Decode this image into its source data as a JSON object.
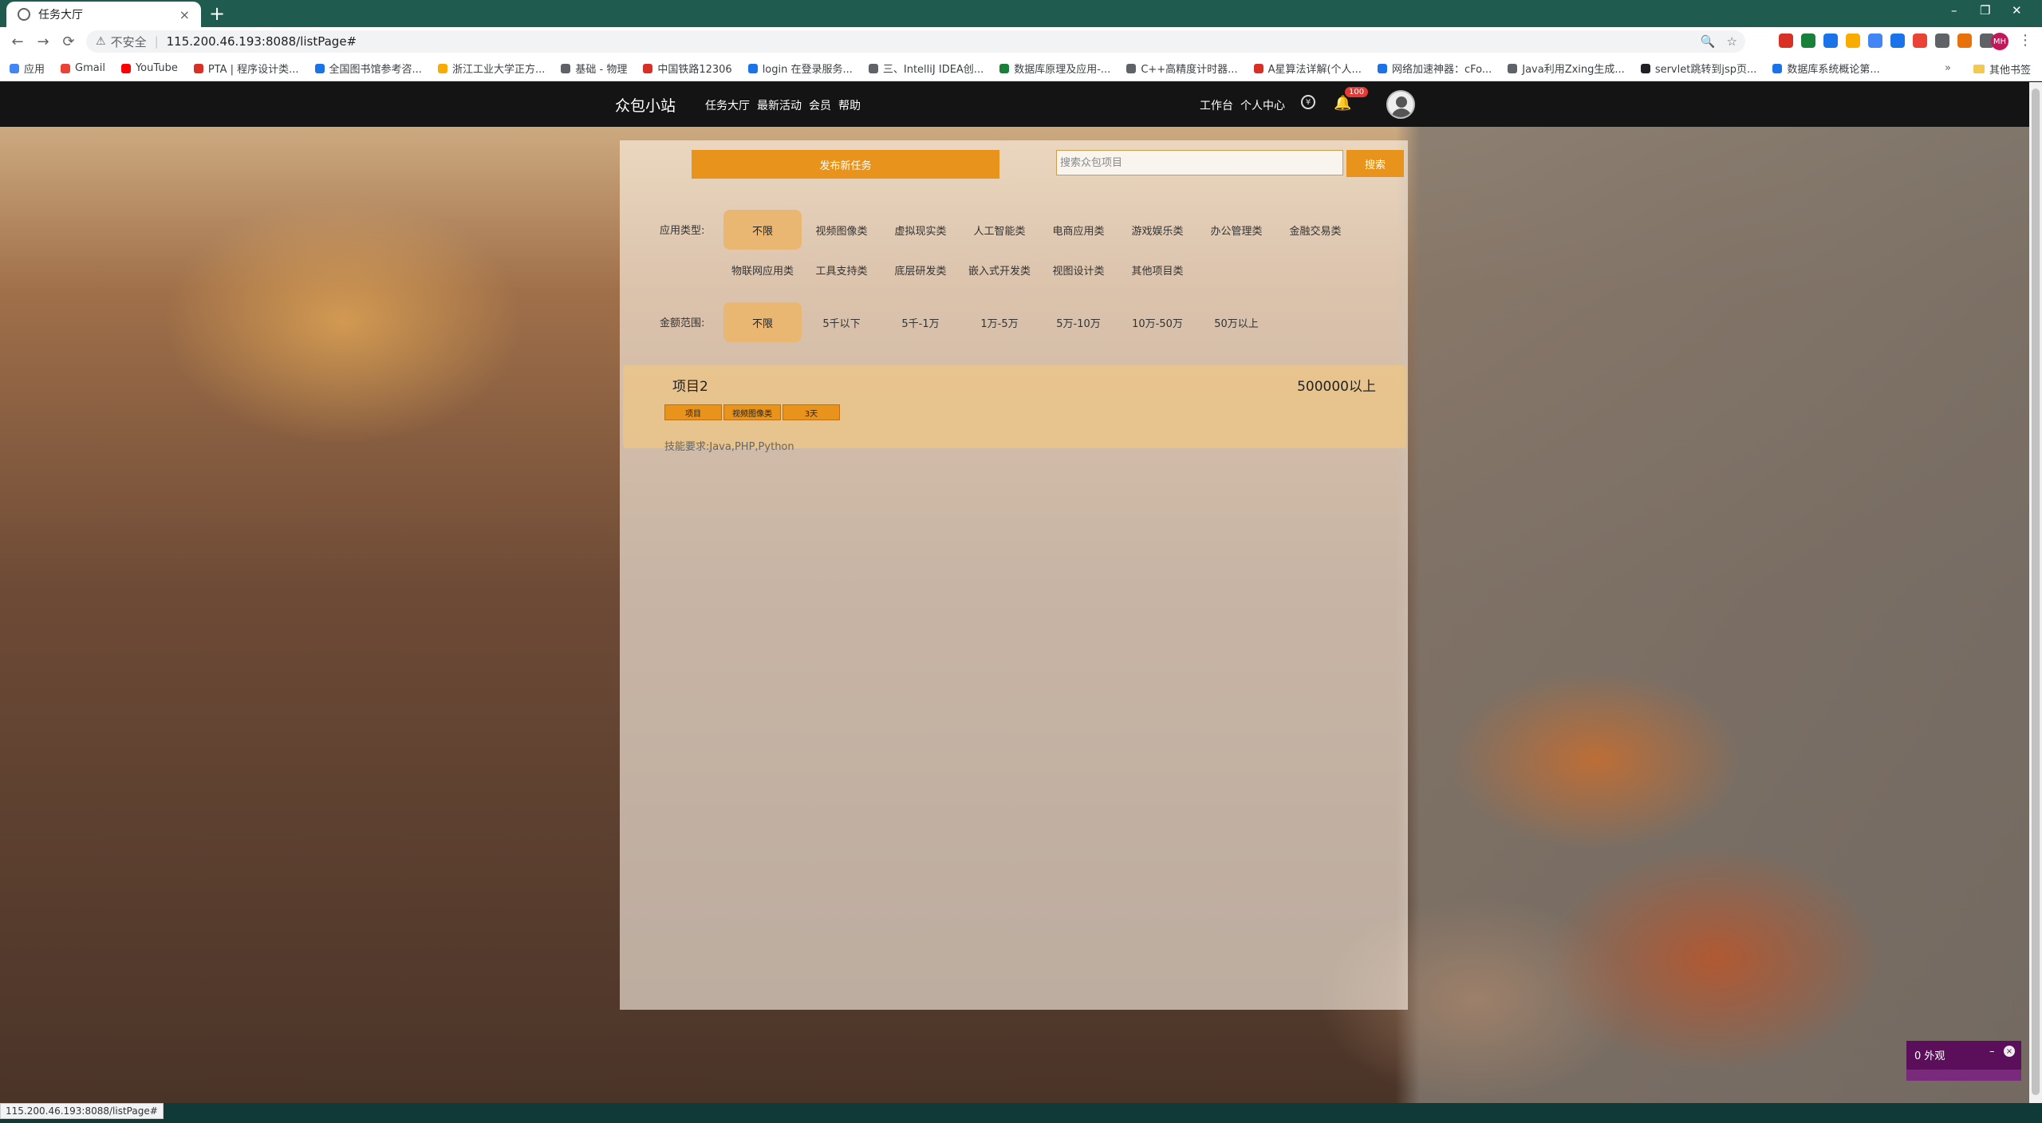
{
  "browser": {
    "tab_title": "任务大厅",
    "tab_close": "×",
    "new_tab": "+",
    "window_controls": [
      "–",
      "❐",
      "✕"
    ],
    "nav_icons": [
      "←",
      "→",
      "⟳"
    ],
    "security_icon": "warning-triangle-icon",
    "security_text": "不安全",
    "url": "115.200.46.193:8088/listPage#",
    "status_url": "115.200.46.193:8088/listPage#",
    "profile_initials": "MH",
    "bookmarks": [
      {
        "label": "应用",
        "color": "#4285f4"
      },
      {
        "label": "Gmail",
        "color": "#ea4335"
      },
      {
        "label": "YouTube",
        "color": "#ff0000"
      },
      {
        "label": "PTA | 程序设计类...",
        "color": "#d93025"
      },
      {
        "label": "全国图书馆参考咨...",
        "color": "#1a73e8"
      },
      {
        "label": "浙江工业大学正方...",
        "color": "#f9ab00"
      },
      {
        "label": "基础 - 物理",
        "color": "#5f6368"
      },
      {
        "label": "中国铁路12306",
        "color": "#d93025"
      },
      {
        "label": "login 在登录服务...",
        "color": "#1a73e8"
      },
      {
        "label": "三、IntelliJ IDEA创...",
        "color": "#5f6368"
      },
      {
        "label": "数据库原理及应用-...",
        "color": "#188038"
      },
      {
        "label": "C++高精度计时器...",
        "color": "#5f6368"
      },
      {
        "label": "A星算法详解(个人...",
        "color": "#d93025"
      },
      {
        "label": "网络加速神器：cFo...",
        "color": "#1a73e8"
      },
      {
        "label": "Java利用Zxing生成...",
        "color": "#5f6368"
      },
      {
        "label": "servlet跳转到jsp页...",
        "color": "#202124"
      },
      {
        "label": "数据库系统概论第...",
        "color": "#1a73e8"
      }
    ],
    "bookmarks_more": "»",
    "other_bookmarks": "其他书签"
  },
  "site": {
    "logo": "众包小站",
    "nav": [
      "任务大厅",
      "最新活动",
      "会员",
      "帮助"
    ],
    "right_nav": [
      "工作台",
      "个人中心"
    ],
    "coin_glyph": "¥",
    "bell_glyph": "🔔",
    "notification_count": "100"
  },
  "panel": {
    "publish_label": "发布新任务",
    "search_placeholder": "搜索众包项目",
    "search_label": "搜索",
    "app_type_label": "应用类型:",
    "app_types_row1": [
      "不限",
      "视频图像类",
      "虚拟现实类",
      "人工智能类",
      "电商应用类",
      "游戏娱乐类",
      "办公管理类",
      "金融交易类"
    ],
    "app_types_row2": [
      "物联网应用类",
      "工具支持类",
      "底层研发类",
      "嵌入式开发类",
      "视图设计类",
      "其他项目类"
    ],
    "amount_label": "金额范围:",
    "amounts": [
      "不限",
      "5千以下",
      "5千-1万",
      "1万-5万",
      "5万-10万",
      "10万-50万",
      "50万以上"
    ],
    "selected_app_type": "不限",
    "selected_amount": "不限"
  },
  "task": {
    "title": "项目2",
    "amount": "500000以上",
    "tags": [
      "项目",
      "视频图像类",
      "3天"
    ],
    "skills": "技能要求:Java,PHP,Python"
  },
  "widget": {
    "label": "0 外观",
    "minimize": "–",
    "close": "×"
  },
  "colors": {
    "accent": "#e8941c",
    "active_chip": "#eab773",
    "header_bg": "#141414"
  }
}
